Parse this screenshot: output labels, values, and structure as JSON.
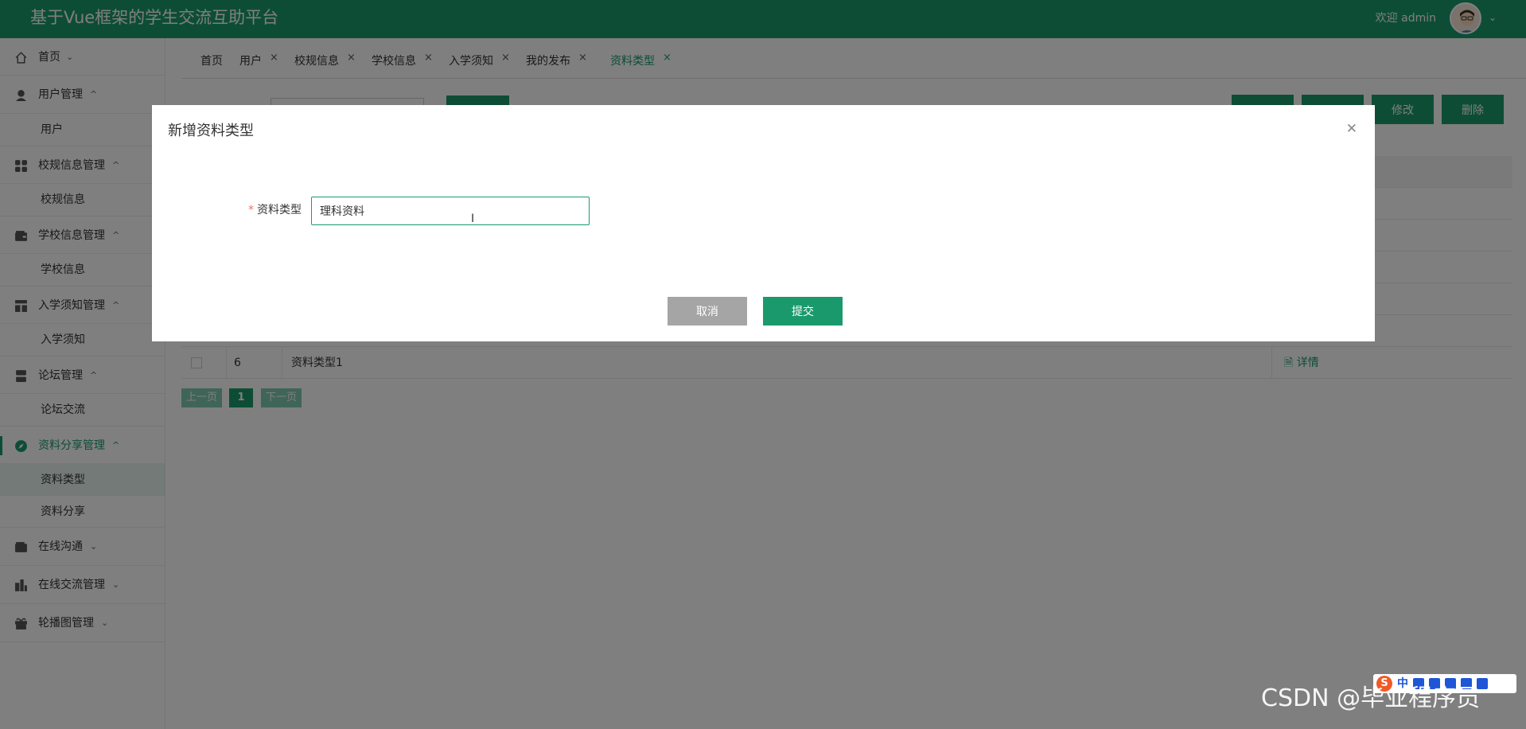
{
  "header": {
    "app_title": "基于Vue框架的学生交流互助平台",
    "welcome": "欢迎 admin"
  },
  "sidebar": {
    "items": [
      {
        "label": "首页",
        "arrow": "down"
      },
      {
        "label": "用户管理",
        "arrow": "up",
        "children": [
          "用户"
        ]
      },
      {
        "label": "校规信息管理",
        "arrow": "up",
        "children": [
          "校规信息"
        ]
      },
      {
        "label": "学校信息管理",
        "arrow": "up",
        "children": [
          "学校信息"
        ]
      },
      {
        "label": "入学须知管理",
        "arrow": "up",
        "children": [
          "入学须知"
        ]
      },
      {
        "label": "论坛管理",
        "arrow": "up",
        "children": [
          "论坛交流"
        ]
      },
      {
        "label": "资料分享管理",
        "arrow": "up",
        "children": [
          "资料类型",
          "资料分享"
        ]
      },
      {
        "label": "在线沟通",
        "arrow": "down"
      },
      {
        "label": "在线交流管理",
        "arrow": "down"
      },
      {
        "label": "轮播图管理",
        "arrow": "down"
      }
    ],
    "active_item": "资料分享管理",
    "current_child": "资料类型"
  },
  "tabs": [
    {
      "label": "首页",
      "closable": false
    },
    {
      "label": "用户",
      "closable": true
    },
    {
      "label": "校规信息",
      "closable": true
    },
    {
      "label": "学校信息",
      "closable": true
    },
    {
      "label": "入学须知",
      "closable": true
    },
    {
      "label": "我的发布",
      "closable": true
    },
    {
      "label": "资料类型",
      "closable": true,
      "active": true
    }
  ],
  "toolbar": {
    "edit_label": "修改",
    "delete_label": "删除"
  },
  "table": {
    "rows": [
      {
        "id": "6",
        "name": "资料类型1",
        "op": "详情"
      }
    ]
  },
  "pager": {
    "prev": "上一页",
    "current": "1",
    "next": "下一页"
  },
  "dialog": {
    "title": "新增资料类型",
    "field_label": "资料类型",
    "field_value": "理科资料",
    "cancel_label": "取消",
    "submit_label": "提交"
  },
  "ime": {
    "logo": "S",
    "mode": "中"
  },
  "watermark": "CSDN @毕业程序员",
  "colors": {
    "primary": "#1a9a6c",
    "cancel": "#a5a5a5",
    "required": "#f56c6c"
  }
}
